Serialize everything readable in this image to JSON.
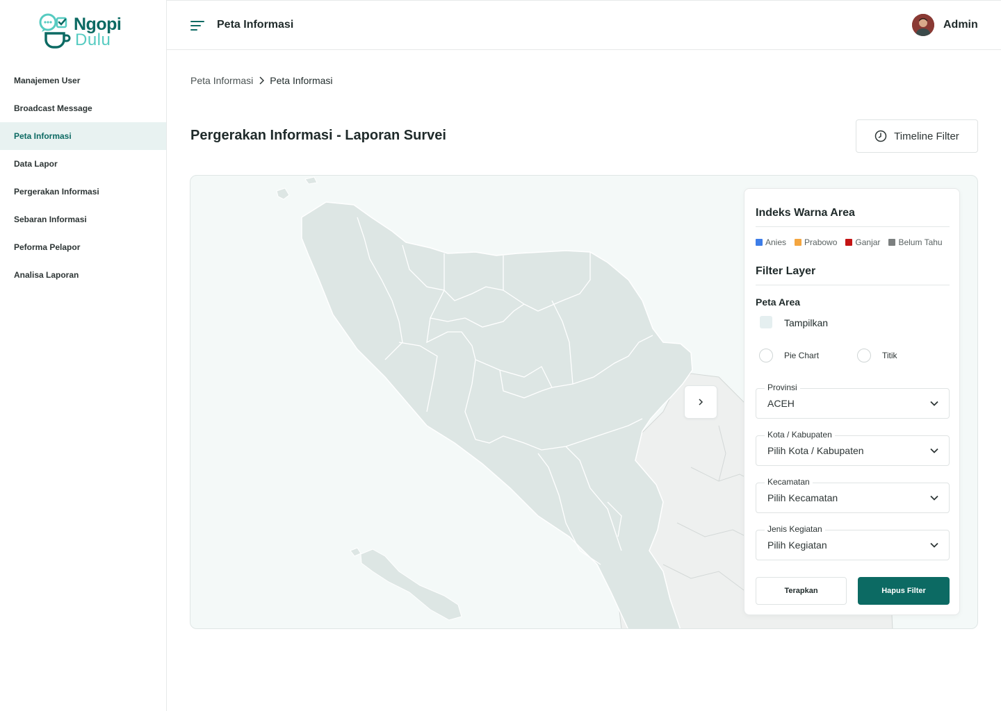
{
  "app": {
    "logo_top": "Ngopi",
    "logo_bottom": "Dulu"
  },
  "sidebar": {
    "items": [
      {
        "label": "Manajemen User",
        "active": false
      },
      {
        "label": "Broadcast Message",
        "active": false
      },
      {
        "label": "Peta Informasi",
        "active": true
      },
      {
        "label": "Data Lapor",
        "active": false
      },
      {
        "label": "Pergerakan Informasi",
        "active": false
      },
      {
        "label": "Sebaran Informasi",
        "active": false
      },
      {
        "label": "Peforma Pelapor",
        "active": false
      },
      {
        "label": "Analisa Laporan",
        "active": false
      }
    ]
  },
  "header": {
    "title": "Peta Informasi",
    "user_name": "Admin"
  },
  "breadcrumb": {
    "parent": "Peta Informasi",
    "current": "Peta Informasi"
  },
  "main": {
    "title": "Pergerakan Informasi - Laporan Survei",
    "timeline_button": "Timeline Filter"
  },
  "panel": {
    "legend_title": "Indeks Warna Area",
    "legend": [
      {
        "label": "Anies",
        "color": "#3d7de8"
      },
      {
        "label": "Prabowo",
        "color": "#f4a640"
      },
      {
        "label": "Ganjar",
        "color": "#c41414"
      },
      {
        "label": "Belum Tahu",
        "color": "#7b7f7f"
      }
    ],
    "filter_title": "Filter Layer",
    "peta_area_label": "Peta Area",
    "tampilkan_label": "Tampilkan",
    "radio_pie": "Pie Chart",
    "radio_titik": "Titik",
    "fields": [
      {
        "label": "Provinsi",
        "value": "ACEH"
      },
      {
        "label": "Kota / Kabupaten",
        "value": "Pilih Kota / Kabupaten"
      },
      {
        "label": "Kecamatan",
        "value": "Pilih Kecamatan"
      },
      {
        "label": "Jenis Kegiatan",
        "value": "Pilih Kegiatan"
      }
    ],
    "apply_button": "Terapkan",
    "clear_button": "Hapus Filter"
  },
  "colors": {
    "primary": "#0c6a63",
    "accent": "#56cbc1",
    "map_region": "#dde6e4",
    "map_outside": "#eef0ef",
    "map_background": "#f4f9f8"
  }
}
